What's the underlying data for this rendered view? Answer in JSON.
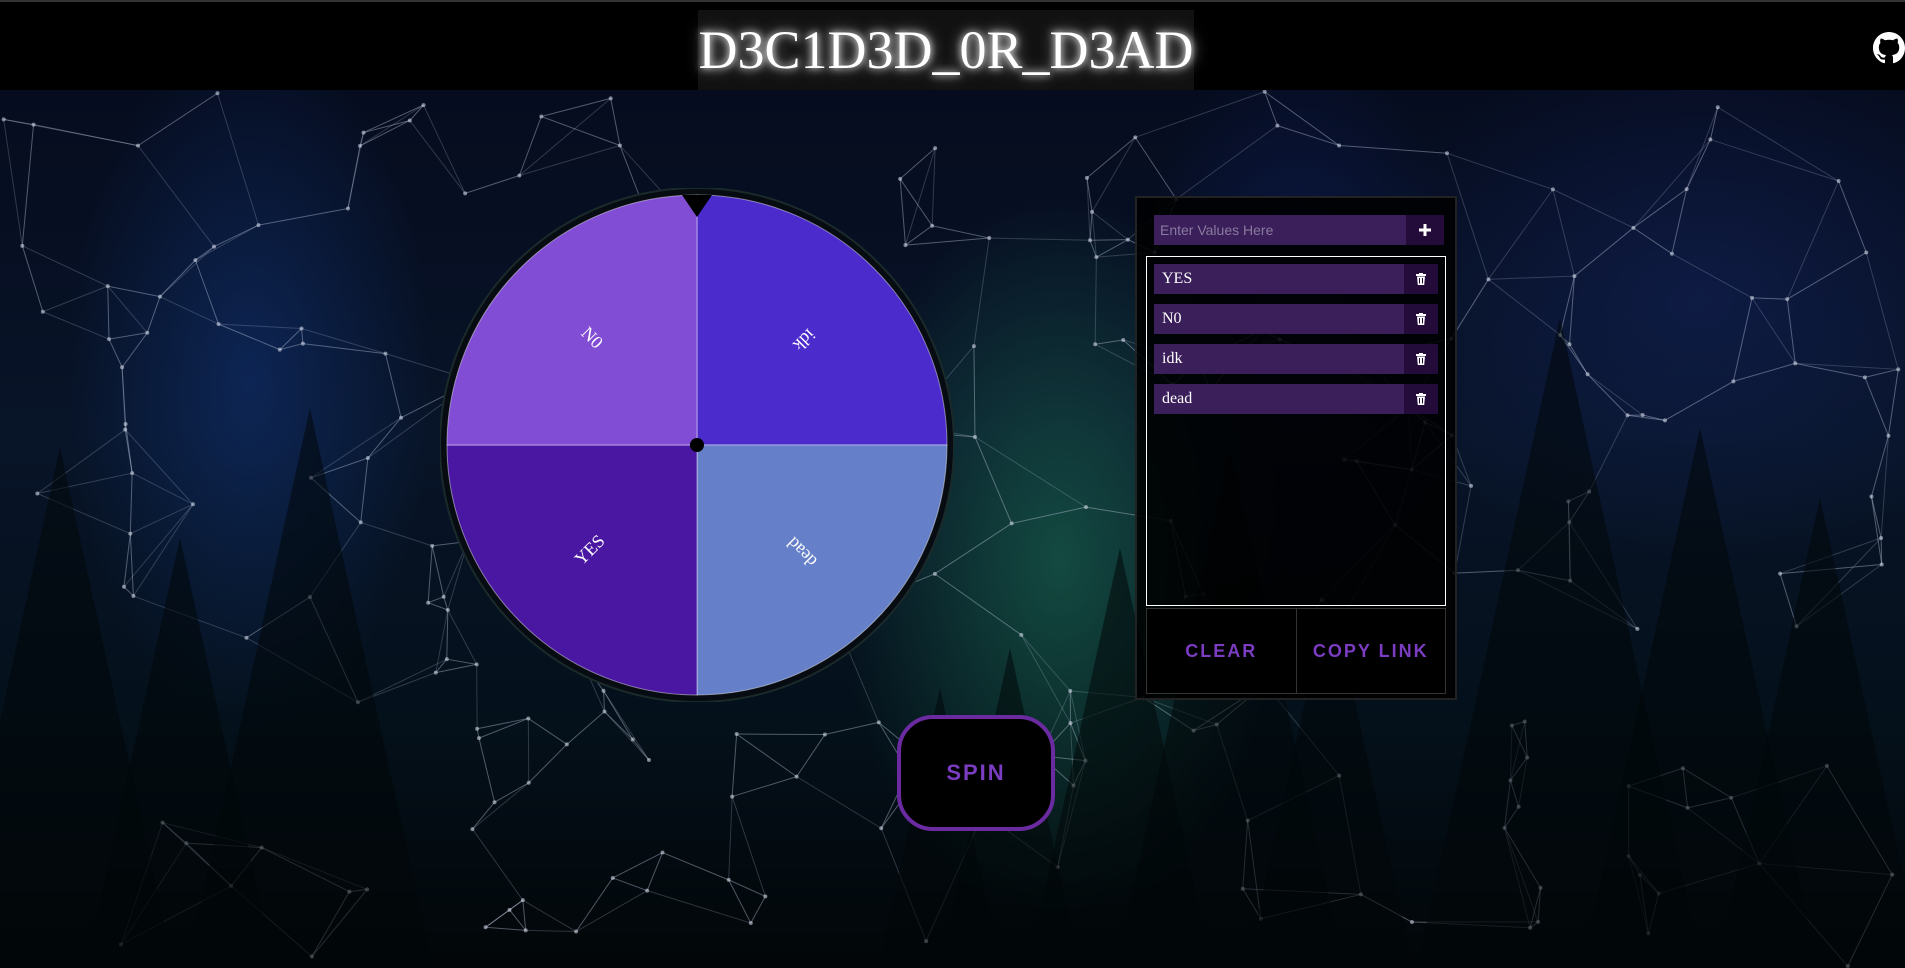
{
  "header": {
    "title": "D3C1D3D_0R_D3AD",
    "github_icon": "github-icon"
  },
  "wheel": {
    "segments": [
      {
        "label": "idk",
        "color": "#4b2bcb"
      },
      {
        "label": "dead",
        "color": "#6580c8"
      },
      {
        "label": "YES",
        "color": "#4a17a3"
      },
      {
        "label": "N0",
        "color": "#814dd4"
      }
    ],
    "pointer_icon": "triangle-pointer-icon"
  },
  "spin": {
    "label": "SPIN"
  },
  "panel": {
    "input_placeholder": "Enter Values Here",
    "add_icon": "plus-icon",
    "delete_icon": "trash-icon",
    "items": [
      {
        "value": "YES"
      },
      {
        "value": "N0"
      },
      {
        "value": "idk"
      },
      {
        "value": "dead"
      }
    ],
    "clear_label": "CLEAR",
    "copy_link_label": "COPY LINK"
  },
  "colors": {
    "accent": "#7a3cc0",
    "spin_border": "#6a2aa0",
    "item_bg": "#3a1f5a",
    "item_btn_bg": "#240c3a"
  }
}
